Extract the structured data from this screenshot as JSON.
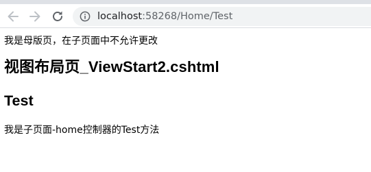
{
  "browser": {
    "url_host": "localhost",
    "url_rest": ":58268/Home/Test",
    "icons": {
      "back": "arrow-left-icon",
      "forward": "arrow-right-icon",
      "reload": "reload-icon",
      "info": "info-icon"
    },
    "colors": {
      "toolbar_icon": "#5f6368",
      "omnibox_bg": "#f1f3f4",
      "tab_strip": "#dee1e6"
    }
  },
  "page": {
    "layout_note": "我是母版页，在子页面中不允许更改",
    "layout_heading": "视图布局页_ViewStart2.cshtml",
    "view_heading": "Test",
    "view_text": "我是子页面-home控制器的Test方法"
  }
}
